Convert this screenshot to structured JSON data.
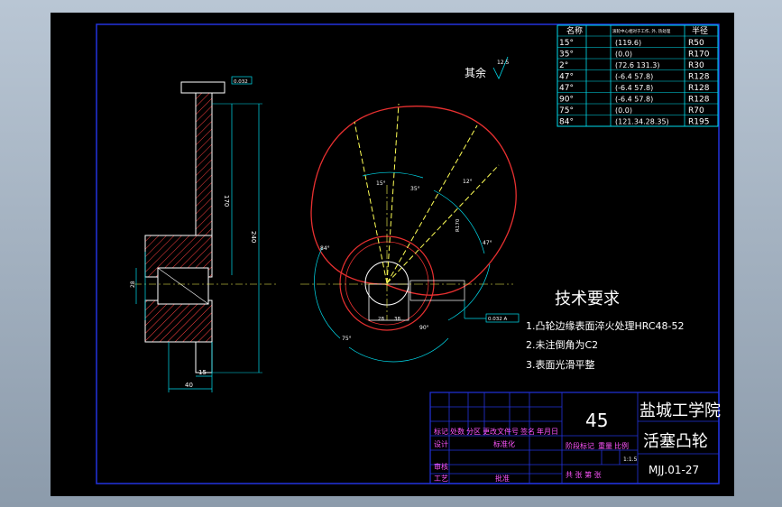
{
  "roughness": {
    "label": "其余",
    "value": "12.5"
  },
  "tech": {
    "title": "技术要求",
    "items": [
      "1.凸轮边缘表面淬火处理HRC48-52",
      "2.未注倒角为C2",
      "3.表面光滑平整"
    ]
  },
  "table": {
    "headers": [
      "名称",
      "滚轮中心相对于工作, 外, 热处理",
      "半径"
    ],
    "rows": [
      [
        "15°",
        "",
        "(119.6)",
        "R50"
      ],
      [
        "35°",
        "",
        "(0.0)",
        "R170"
      ],
      [
        "2°",
        "",
        "(72.6 131.3)",
        "R30"
      ],
      [
        "47°",
        "",
        "(-6.4 57.8)",
        "R128"
      ],
      [
        "47°",
        "",
        "(-6.4 57.8)",
        "R128"
      ],
      [
        "90°",
        "",
        "(-6.4 57.8)",
        "R128"
      ],
      [
        "75°",
        "",
        "(0.0)",
        "R70"
      ],
      [
        "84°",
        "",
        "(121.34.28.35)",
        "R195"
      ]
    ]
  },
  "title_block": {
    "material": "45",
    "school": "盐城工学院",
    "part_name": "活塞凸轮",
    "drawing_no": "MJJ.01-27",
    "scale": "1:1.5",
    "row_labels": [
      "标记",
      "处数",
      "分区",
      "更改文件号",
      "签名",
      "年月日"
    ],
    "design": "设计",
    "standard": "标准化",
    "stage": "阶段标记",
    "weight": "重量",
    "ratio": "比例",
    "review": "审核",
    "process": "工艺",
    "approve": "批准",
    "sheet": "共  张  第  张"
  },
  "dims": {
    "width40": "40",
    "w15": "15",
    "h170": "170",
    "h240": "240",
    "d28": "28",
    "tol": "0.032",
    "ang15": "15°",
    "ang35": "35°",
    "ang12": "12°",
    "ang47": "47°",
    "ang84": "84°",
    "ang90": "90°",
    "ang75": "75°",
    "r170": "R170",
    "d28b": "28",
    "d38": "38",
    "flat": "0.032 A"
  },
  "colors": {
    "frame": "#2233dd",
    "profile": "#e83030",
    "center": "#ffff55",
    "dim": "#00ddee",
    "text": "#ffffff",
    "table_text": "#ff55ff"
  }
}
